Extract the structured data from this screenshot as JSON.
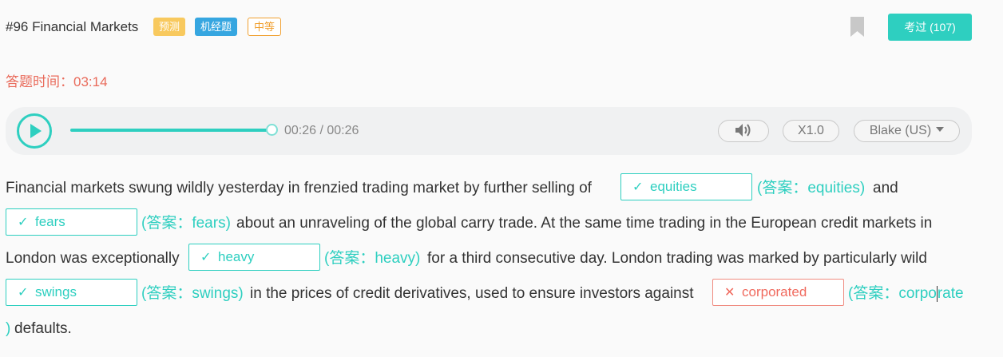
{
  "header": {
    "title": "#96 Financial Markets",
    "tags": [
      "预测",
      "机经题",
      "中等"
    ],
    "exam_button": "考过 (107)",
    "bookmark_icon": "bookmark-icon"
  },
  "timer": {
    "label": "答题时间：",
    "value": "03:14"
  },
  "player": {
    "current_time": "00:26 / 00:26",
    "progress": 1.0,
    "volume_icon": "volume-icon",
    "speed": "X1.0",
    "voice": "Blake (US)"
  },
  "passage": {
    "segments": [
      "Financial markets swung wildly yesterday in frenzied trading market by further selling of",
      "and",
      "about an unraveling of the global carry trade. At the same time trading in the European credit markets in",
      "London was exceptionally",
      "for a third consecutive day. London trading was marked by particularly wild",
      "in the prices of credit derivatives, used to ensure investors against",
      "defaults."
    ],
    "blanks": [
      {
        "mark": "✓",
        "value": "equities",
        "answer": "(答案：equities)",
        "correct": true
      },
      {
        "mark": "✓",
        "value": "fears",
        "answer": "(答案：fears)",
        "correct": true
      },
      {
        "mark": "✓",
        "value": "heavy",
        "answer": "(答案：heavy)",
        "correct": true
      },
      {
        "mark": "✓",
        "value": "swings",
        "answer": "(答案：swings)",
        "correct": true
      },
      {
        "mark": "✕",
        "value": "corporated",
        "answer_part1": "(答案：corpo",
        "answer_part2": "rate",
        "answer_part3": ")",
        "correct": false
      }
    ]
  },
  "colors": {
    "accent": "#2ecfc0",
    "error": "#f06a5e",
    "timer": "#e96a5a"
  }
}
